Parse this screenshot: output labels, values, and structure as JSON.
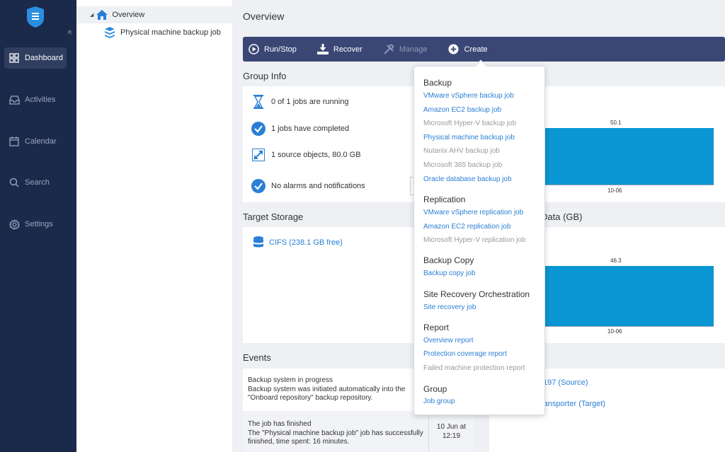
{
  "nav": {
    "items": [
      {
        "label": "Dashboard",
        "icon": "dashboard-icon",
        "active": true
      },
      {
        "label": "Activities",
        "icon": "inbox-icon"
      },
      {
        "label": "Calendar",
        "icon": "calendar-icon"
      },
      {
        "label": "Search",
        "icon": "search-icon"
      },
      {
        "label": "Settings",
        "icon": "gear-icon"
      }
    ]
  },
  "tree": {
    "root": "Overview",
    "child": "Physical machine backup job"
  },
  "main": {
    "title": "Overview",
    "toolbar": {
      "run_stop": "Run/Stop",
      "recover": "Recover",
      "manage": "Manage",
      "create": "Create"
    },
    "group_info": {
      "title": "Group Info",
      "running": "0 of 1 jobs are running",
      "completed": "1 jobs have completed",
      "source": "1 source objects, 80.0 GB",
      "alarms": "No alarms and notifications"
    },
    "chart_top": {
      "value_label": "50.1",
      "tick": "10-06"
    },
    "target_storage": {
      "title": "Target Storage",
      "item": "CIFS (238.1 GB free)"
    },
    "chart_bottom": {
      "title_fragment": "Data (GB)",
      "value_label": "46.3",
      "tick": "10-06"
    },
    "events": {
      "title": "Events",
      "items": [
        {
          "title": "Backup system in progress",
          "body": "Backup system was initiated automatically into the \"Onboard repository\" backup repository.",
          "time": ""
        },
        {
          "title": "The job has finished",
          "body": "The \"Physical machine backup job\" job has successfully finished, time spent: 16 minutes.",
          "time": "10 Jun at 12:19"
        }
      ]
    },
    "right_links": {
      "source": "197 (Source)",
      "target": "ransporter (Target)"
    }
  },
  "chart_data": [
    {
      "type": "bar",
      "categories": [
        "10-06"
      ],
      "values": [
        50.1
      ],
      "title": ""
    },
    {
      "type": "bar",
      "categories": [
        "10-06"
      ],
      "values": [
        46.3
      ],
      "title": "Data (GB)"
    }
  ],
  "dropdown": {
    "groups": [
      {
        "title": "Backup",
        "items": [
          {
            "label": "VMware vSphere backup job",
            "enabled": true
          },
          {
            "label": "Amazon EC2 backup job",
            "enabled": true
          },
          {
            "label": "Microsoft Hyper-V backup job",
            "enabled": false
          },
          {
            "label": "Physical machine backup job",
            "enabled": true
          },
          {
            "label": "Nutanix AHV backup job",
            "enabled": false
          },
          {
            "label": "Microsoft 365 backup job",
            "enabled": false
          },
          {
            "label": "Oracle database backup job",
            "enabled": true
          }
        ]
      },
      {
        "title": "Replication",
        "items": [
          {
            "label": "VMware vSphere replication job",
            "enabled": true
          },
          {
            "label": "Amazon EC2 replication job",
            "enabled": true
          },
          {
            "label": "Microsoft Hyper-V replication job",
            "enabled": false
          }
        ]
      },
      {
        "title": "Backup Copy",
        "items": [
          {
            "label": "Backup copy job",
            "enabled": true
          }
        ]
      },
      {
        "title": "Site Recovery Orchestration",
        "items": [
          {
            "label": "Site recovery job",
            "enabled": true
          }
        ]
      },
      {
        "title": "Report",
        "items": [
          {
            "label": "Overview report",
            "enabled": true
          },
          {
            "label": "Protection coverage report",
            "enabled": true
          },
          {
            "label": "Failed machine protection report",
            "enabled": false
          }
        ]
      },
      {
        "title": "Group",
        "items": [
          {
            "label": "Job group",
            "enabled": true
          }
        ]
      }
    ]
  },
  "colors": {
    "nav_bg": "#1b2a4a",
    "toolbar_bg": "#3a4775",
    "accent": "#2a7fd4",
    "bar": "#0a96d3"
  }
}
